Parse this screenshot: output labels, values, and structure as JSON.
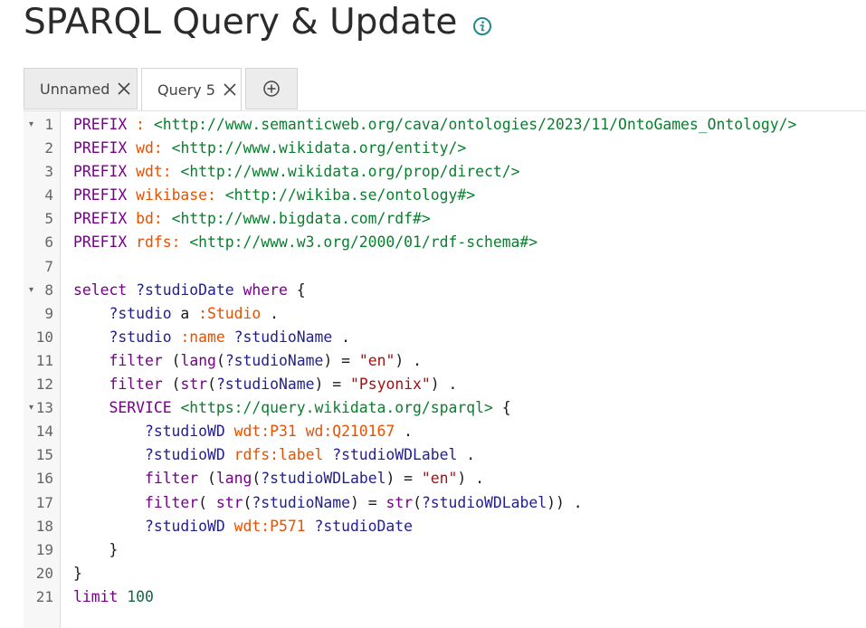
{
  "page": {
    "title": "SPARQL Query & Update"
  },
  "tabs": [
    {
      "label": "Unnamed",
      "active": false
    },
    {
      "label": "Query 5",
      "active": true
    }
  ],
  "colors": {
    "keyword": "#770088",
    "prefixed_name": "#e65100",
    "iri": "#0a7e2e",
    "variable": "#23208f",
    "string": "#a11111",
    "number": "#116644"
  },
  "editor": {
    "lines": [
      {
        "n": "1",
        "fold": true,
        "tokens": [
          [
            "kw",
            "PREFIX"
          ],
          [
            "op",
            " "
          ],
          [
            "pn",
            ":"
          ],
          [
            "op",
            " "
          ],
          [
            "iri",
            "<http://www.semanticweb.org/cava/ontologies/2023/11/OntoGames_Ontology/>"
          ]
        ]
      },
      {
        "n": "2",
        "tokens": [
          [
            "kw",
            "PREFIX"
          ],
          [
            "op",
            " "
          ],
          [
            "pn",
            "wd:"
          ],
          [
            "op",
            " "
          ],
          [
            "iri",
            "<http://www.wikidata.org/entity/>"
          ]
        ]
      },
      {
        "n": "3",
        "tokens": [
          [
            "kw",
            "PREFIX"
          ],
          [
            "op",
            " "
          ],
          [
            "pn",
            "wdt:"
          ],
          [
            "op",
            " "
          ],
          [
            "iri",
            "<http://www.wikidata.org/prop/direct/>"
          ]
        ]
      },
      {
        "n": "4",
        "tokens": [
          [
            "kw",
            "PREFIX"
          ],
          [
            "op",
            " "
          ],
          [
            "pn",
            "wikibase:"
          ],
          [
            "op",
            " "
          ],
          [
            "iri",
            "<http://wikiba.se/ontology#>"
          ]
        ]
      },
      {
        "n": "5",
        "tokens": [
          [
            "kw",
            "PREFIX"
          ],
          [
            "op",
            " "
          ],
          [
            "pn",
            "bd:"
          ],
          [
            "op",
            " "
          ],
          [
            "iri",
            "<http://www.bigdata.com/rdf#>"
          ]
        ]
      },
      {
        "n": "6",
        "tokens": [
          [
            "kw",
            "PREFIX"
          ],
          [
            "op",
            " "
          ],
          [
            "pn",
            "rdfs:"
          ],
          [
            "op",
            " "
          ],
          [
            "iri",
            "<http://www.w3.org/2000/01/rdf-schema#>"
          ]
        ]
      },
      {
        "n": "7",
        "tokens": []
      },
      {
        "n": "8",
        "fold": true,
        "tokens": [
          [
            "kw",
            "select"
          ],
          [
            "op",
            " "
          ],
          [
            "var",
            "?studioDate"
          ],
          [
            "op",
            " "
          ],
          [
            "kw",
            "where"
          ],
          [
            "op",
            " {"
          ]
        ]
      },
      {
        "n": "9",
        "tokens": [
          [
            "op",
            "    "
          ],
          [
            "var",
            "?studio"
          ],
          [
            "op",
            " a "
          ],
          [
            "pn",
            ":Studio"
          ],
          [
            "op",
            " ."
          ]
        ]
      },
      {
        "n": "10",
        "tokens": [
          [
            "op",
            "    "
          ],
          [
            "var",
            "?studio"
          ],
          [
            "op",
            " "
          ],
          [
            "pn",
            ":name"
          ],
          [
            "op",
            " "
          ],
          [
            "var",
            "?studioName"
          ],
          [
            "op",
            " ."
          ]
        ]
      },
      {
        "n": "11",
        "tokens": [
          [
            "op",
            "    "
          ],
          [
            "kw",
            "filter"
          ],
          [
            "op",
            " ("
          ],
          [
            "kw",
            "lang"
          ],
          [
            "op",
            "("
          ],
          [
            "var",
            "?studioName"
          ],
          [
            "op",
            ") = "
          ],
          [
            "str",
            "\"en\""
          ],
          [
            "op",
            ") ."
          ]
        ]
      },
      {
        "n": "12",
        "tokens": [
          [
            "op",
            "    "
          ],
          [
            "kw",
            "filter"
          ],
          [
            "op",
            " ("
          ],
          [
            "kw",
            "str"
          ],
          [
            "op",
            "("
          ],
          [
            "var",
            "?studioName"
          ],
          [
            "op",
            ") = "
          ],
          [
            "str",
            "\"Psyonix\""
          ],
          [
            "op",
            ") ."
          ]
        ]
      },
      {
        "n": "13",
        "fold": true,
        "tokens": [
          [
            "op",
            "    "
          ],
          [
            "kw",
            "SERVICE"
          ],
          [
            "op",
            " "
          ],
          [
            "iri",
            "<https://query.wikidata.org/sparql>"
          ],
          [
            "op",
            " {"
          ]
        ]
      },
      {
        "n": "14",
        "tokens": [
          [
            "op",
            "        "
          ],
          [
            "var",
            "?studioWD"
          ],
          [
            "op",
            " "
          ],
          [
            "pn",
            "wdt:P31"
          ],
          [
            "op",
            " "
          ],
          [
            "pn",
            "wd:Q210167"
          ],
          [
            "op",
            " ."
          ]
        ]
      },
      {
        "n": "15",
        "tokens": [
          [
            "op",
            "        "
          ],
          [
            "var",
            "?studioWD"
          ],
          [
            "op",
            " "
          ],
          [
            "pn",
            "rdfs:label"
          ],
          [
            "op",
            " "
          ],
          [
            "var",
            "?studioWDLabel"
          ],
          [
            "op",
            " ."
          ]
        ]
      },
      {
        "n": "16",
        "tokens": [
          [
            "op",
            "        "
          ],
          [
            "kw",
            "filter"
          ],
          [
            "op",
            " ("
          ],
          [
            "kw",
            "lang"
          ],
          [
            "op",
            "("
          ],
          [
            "var",
            "?studioWDLabel"
          ],
          [
            "op",
            ") = "
          ],
          [
            "str",
            "\"en\""
          ],
          [
            "op",
            ") ."
          ]
        ]
      },
      {
        "n": "17",
        "tokens": [
          [
            "op",
            "        "
          ],
          [
            "kw",
            "filter"
          ],
          [
            "op",
            "( "
          ],
          [
            "kw",
            "str"
          ],
          [
            "op",
            "("
          ],
          [
            "var",
            "?studioName"
          ],
          [
            "op",
            ") = "
          ],
          [
            "kw",
            "str"
          ],
          [
            "op",
            "("
          ],
          [
            "var",
            "?studioWDLabel"
          ],
          [
            "op",
            ")) ."
          ]
        ]
      },
      {
        "n": "18",
        "tokens": [
          [
            "op",
            "        "
          ],
          [
            "var",
            "?studioWD"
          ],
          [
            "op",
            " "
          ],
          [
            "pn",
            "wdt:P571"
          ],
          [
            "op",
            " "
          ],
          [
            "var",
            "?studioDate"
          ]
        ]
      },
      {
        "n": "19",
        "tokens": [
          [
            "op",
            "    }"
          ]
        ]
      },
      {
        "n": "20",
        "tokens": [
          [
            "op",
            "}"
          ]
        ]
      },
      {
        "n": "21",
        "tokens": [
          [
            "kw",
            "limit"
          ],
          [
            "op",
            " "
          ],
          [
            "num",
            "100"
          ]
        ]
      }
    ]
  }
}
